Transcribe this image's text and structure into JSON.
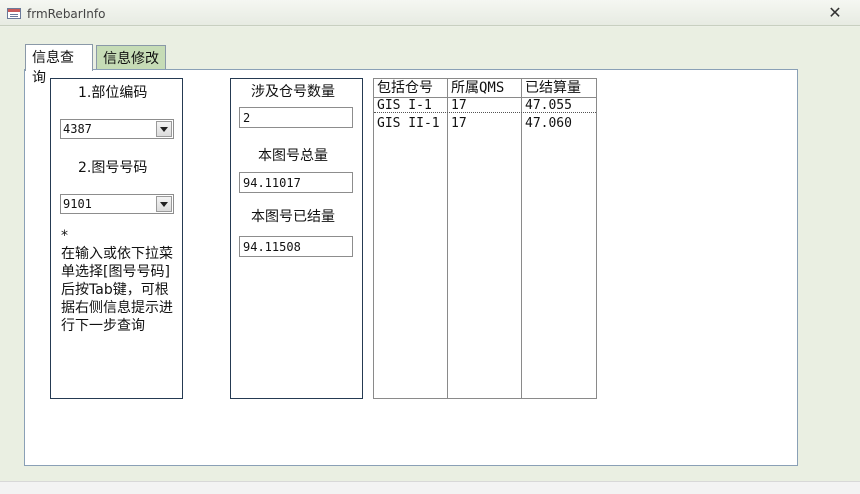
{
  "window": {
    "title": "frmRebarInfo"
  },
  "tabs": [
    {
      "label": "信息查询"
    },
    {
      "label": "信息修改"
    }
  ],
  "left_panel": {
    "part_label": "1.部位编码",
    "part_value": "4387",
    "drawing_label": "2.图号号码",
    "drawing_value": "9101",
    "note": "*\n在输入或依下拉菜单选择[图号号码]后按Tab键，可根据右侧信息提示进行下一步查询"
  },
  "middle_panel": {
    "warehouse_count_label": "涉及仓号数量",
    "warehouse_count_value": "2",
    "total_label": "本图号总量",
    "total_value": "94.11017",
    "settled_label": "本图号已结量",
    "settled_value": "94.11508"
  },
  "grid": {
    "headers": [
      "包括仓号",
      "所属QMS",
      "已结算量"
    ],
    "rows": [
      [
        "GIS I-1",
        "17",
        "47.055"
      ],
      [
        "GIS II-1",
        "17",
        "47.060"
      ]
    ]
  }
}
